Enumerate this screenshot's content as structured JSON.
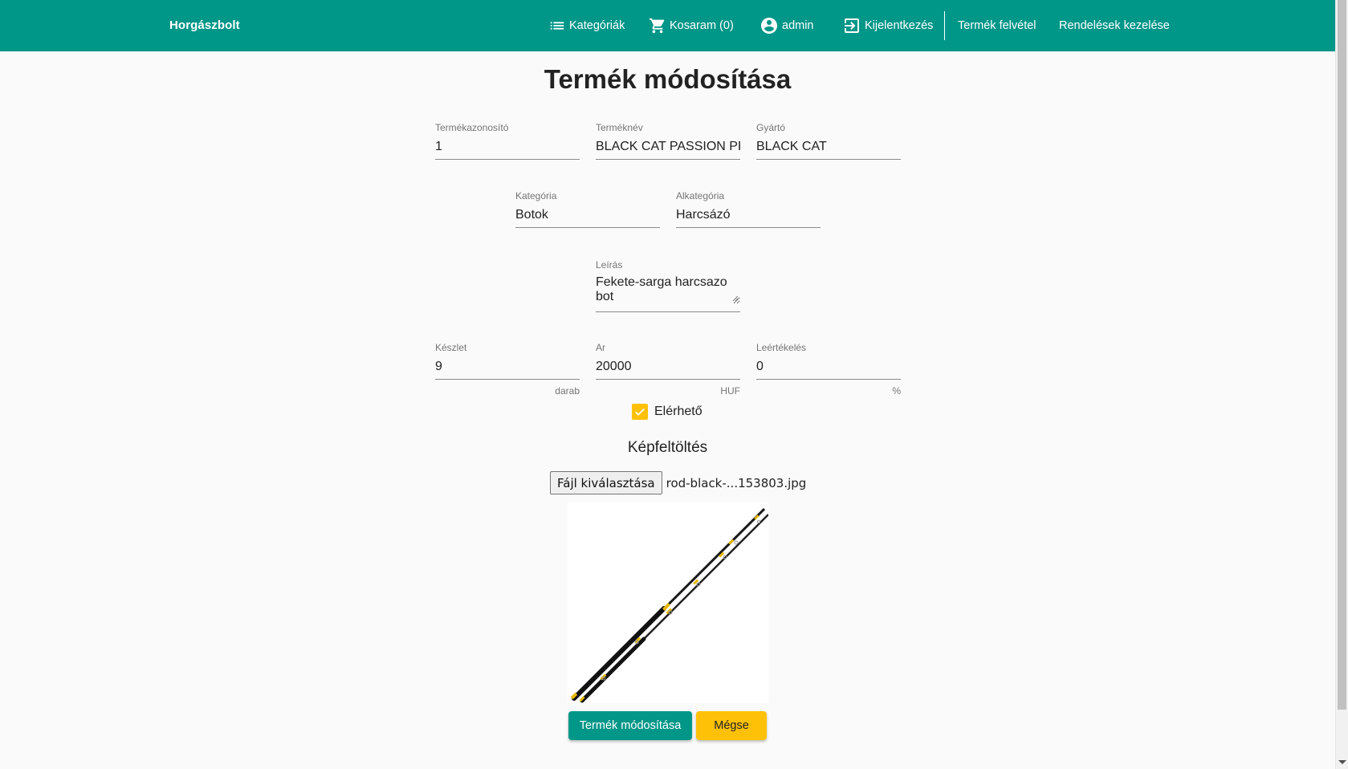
{
  "toolbar": {
    "brand": "Horgászbolt",
    "categories": "Kategóriák",
    "cart": "Kosaram (0)",
    "user": "admin",
    "logout": "Kijelentkezés",
    "add_product": "Termék felvétel",
    "orders": "Rendelések kezelése",
    "icons": [
      "list-icon",
      "cart-icon",
      "account-circle-icon",
      "logout-icon"
    ]
  },
  "page": {
    "title": "Termék módosítása"
  },
  "form": {
    "id": {
      "label": "Termékazonosító",
      "value": "1"
    },
    "name": {
      "label": "Terméknév",
      "value": "BLACK CAT PASSION PRO"
    },
    "manufacturer": {
      "label": "Gyártó",
      "value": "BLACK CAT"
    },
    "category": {
      "label": "Kategória",
      "value": "Botok"
    },
    "subcategory": {
      "label": "Alkategória",
      "value": "Harcsázó"
    },
    "description": {
      "label": "Leírás",
      "value": "Fekete-sarga harcsazo bot"
    },
    "stock": {
      "label": "Készlet",
      "value": "9",
      "hint": "darab"
    },
    "price": {
      "label": "Ar",
      "value": "20000",
      "hint": "HUF"
    },
    "discount": {
      "label": "Leértékelés",
      "value": "0",
      "hint": "%"
    },
    "available": {
      "label": "Elérhető",
      "checked": true
    }
  },
  "upload": {
    "title": "Képfeltöltés",
    "choose_label": "Fájl kiválasztása",
    "file_name": "rod-black-...153803.jpg"
  },
  "actions": {
    "submit": "Termék módosítása",
    "cancel": "Mégse"
  },
  "colors": {
    "primary": "#009688",
    "accent": "#ffc107"
  }
}
